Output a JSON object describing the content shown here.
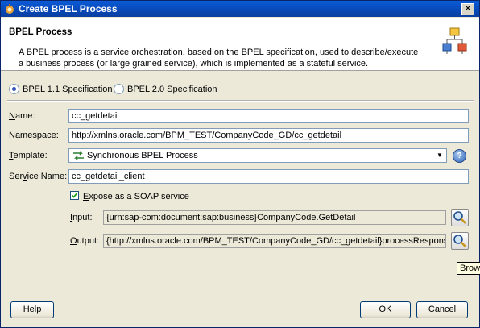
{
  "window": {
    "title": "Create BPEL Process",
    "close_label": "✕"
  },
  "header": {
    "title": "BPEL Process",
    "description": "A BPEL process is a service orchestration, based on the BPEL specification, used to describe/execute a business process (or large grained service), which is implemented as a stateful service.",
    "icon": "bpel-process-icon"
  },
  "spec_options": [
    {
      "label": "BPEL 1.1 Specification",
      "selected": true
    },
    {
      "label": "BPEL 2.0 Specification",
      "selected": false
    }
  ],
  "form": {
    "name_label": "Name:",
    "name_value": "cc_getdetail",
    "namespace_label": "Namespace:",
    "namespace_value": "http://xmlns.oracle.com/BPM_TEST/CompanyCode_GD/cc_getdetail",
    "template_label": "Template:",
    "template_value": "Synchronous BPEL Process",
    "service_name_label": "Service Name:",
    "service_name_value": "cc_getdetail_client",
    "expose_soap_label": "Expose as a SOAP service",
    "expose_soap_checked": true,
    "input_label": "Input:",
    "input_value": "{urn:sap-com:document:sap:business}CompanyCode.GetDetail",
    "output_label": "Output:",
    "output_value": "{http://xmlns.oracle.com/BPM_TEST/CompanyCode_GD/cc_getdetail}processResponse"
  },
  "tooltip": "Browse",
  "buttons": {
    "help": "Help",
    "ok": "OK",
    "cancel": "Cancel"
  }
}
